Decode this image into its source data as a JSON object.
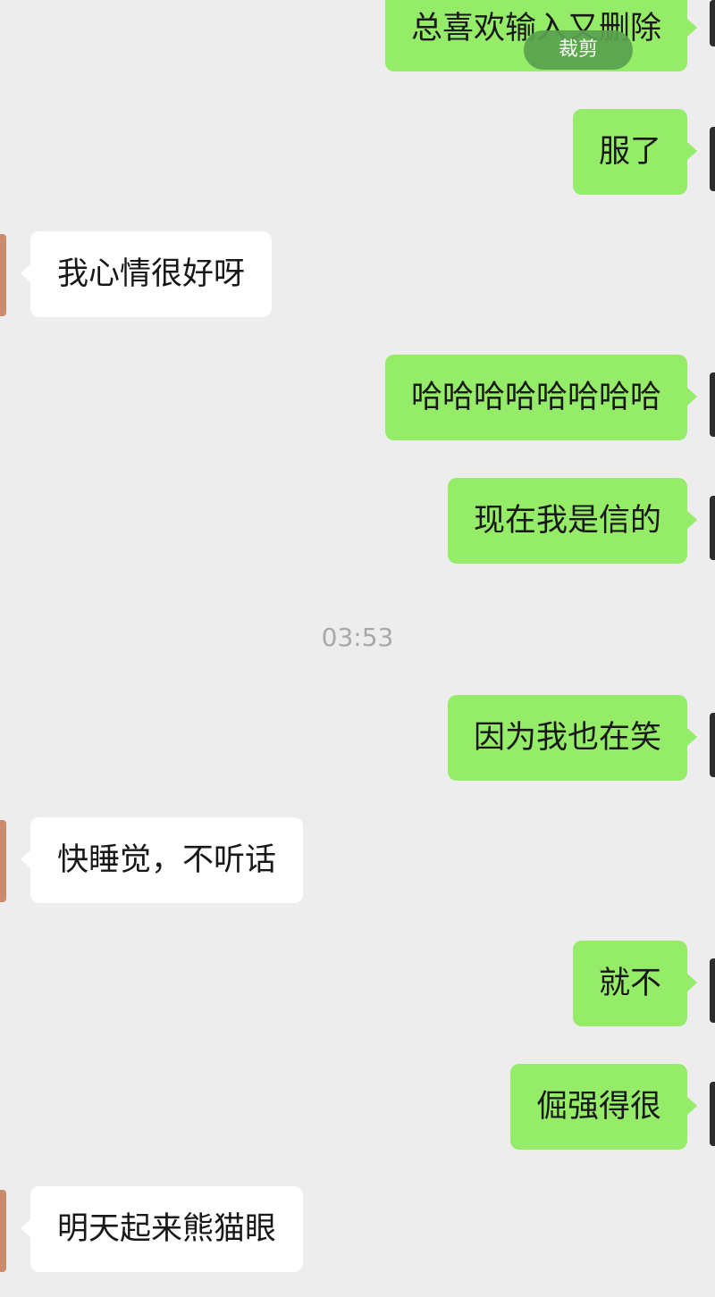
{
  "crop_badge": "裁剪",
  "timestamp": "03:53",
  "messages": [
    {
      "side": "sent",
      "text": "总喜欢输入又删除"
    },
    {
      "side": "sent",
      "text": "服了"
    },
    {
      "side": "received",
      "text": "我心情很好呀"
    },
    {
      "side": "sent",
      "text": "哈哈哈哈哈哈哈哈"
    },
    {
      "side": "sent",
      "text": "现在我是信的"
    },
    {
      "side": "sent",
      "text": "因为我也在笑"
    },
    {
      "side": "received",
      "text": "快睡觉，不听话"
    },
    {
      "side": "sent",
      "text": "就不"
    },
    {
      "side": "sent",
      "text": "倔强得很"
    },
    {
      "side": "received",
      "text": "明天起来熊猫眼"
    }
  ],
  "colors": {
    "background": "#ededed",
    "sent_bubble": "#95ec69",
    "received_bubble": "#ffffff",
    "timestamp": "#a8a8a8"
  }
}
